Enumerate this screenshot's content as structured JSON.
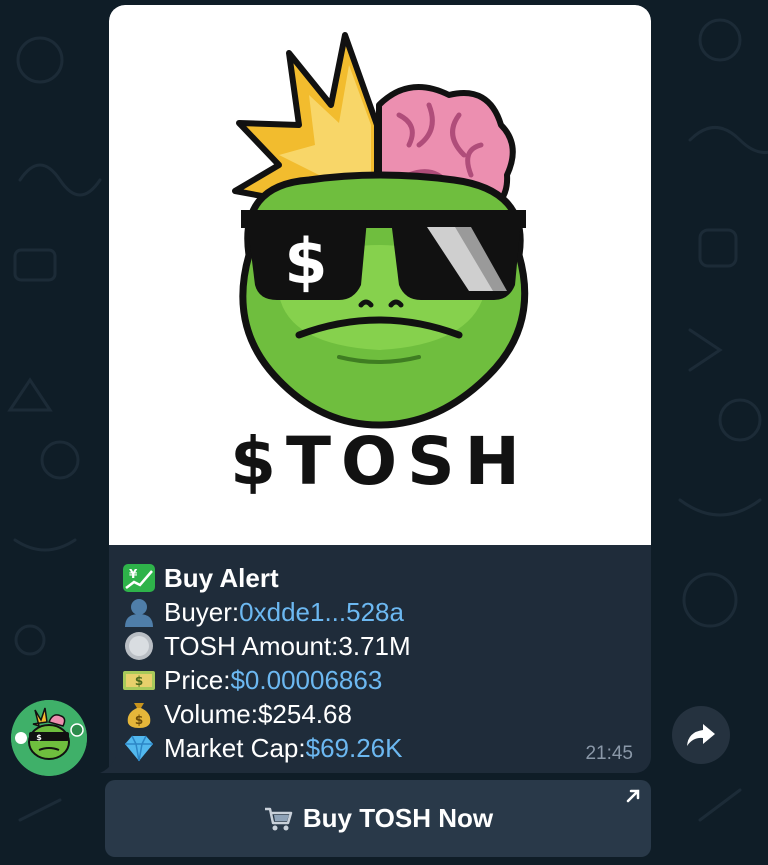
{
  "message": {
    "brand_text": "$TOSH",
    "lines": {
      "alert_title": "Buy Alert",
      "buyer_label": "Buyer: ",
      "buyer_value": "0xdde1...528a",
      "amount_label": "TOSH Amount: ",
      "amount_value": "3.71M",
      "price_label": "Price: ",
      "price_value": "$0.00006863",
      "volume_label": "Volume: ",
      "volume_value": "$254.68",
      "mcap_label": "Market Cap: ",
      "mcap_value": "$69.26K"
    },
    "time": "21:45"
  },
  "buttons": {
    "buy_label": "Buy TOSH Now"
  },
  "colors": {
    "link": "#6cb8f1",
    "bubble": "#1f2c3a",
    "background": "#0f1d27",
    "button": "#293949"
  },
  "icons": {
    "chart": "chart-yen-icon",
    "buyer": "bust-silhouette-icon",
    "amount": "coin-icon",
    "price": "dollar-banknote-icon",
    "volume": "money-bag-icon",
    "mcap": "gem-icon",
    "forward": "forward-arrow-icon",
    "cart": "shopping-cart-icon",
    "external": "external-link-arrow-icon"
  }
}
